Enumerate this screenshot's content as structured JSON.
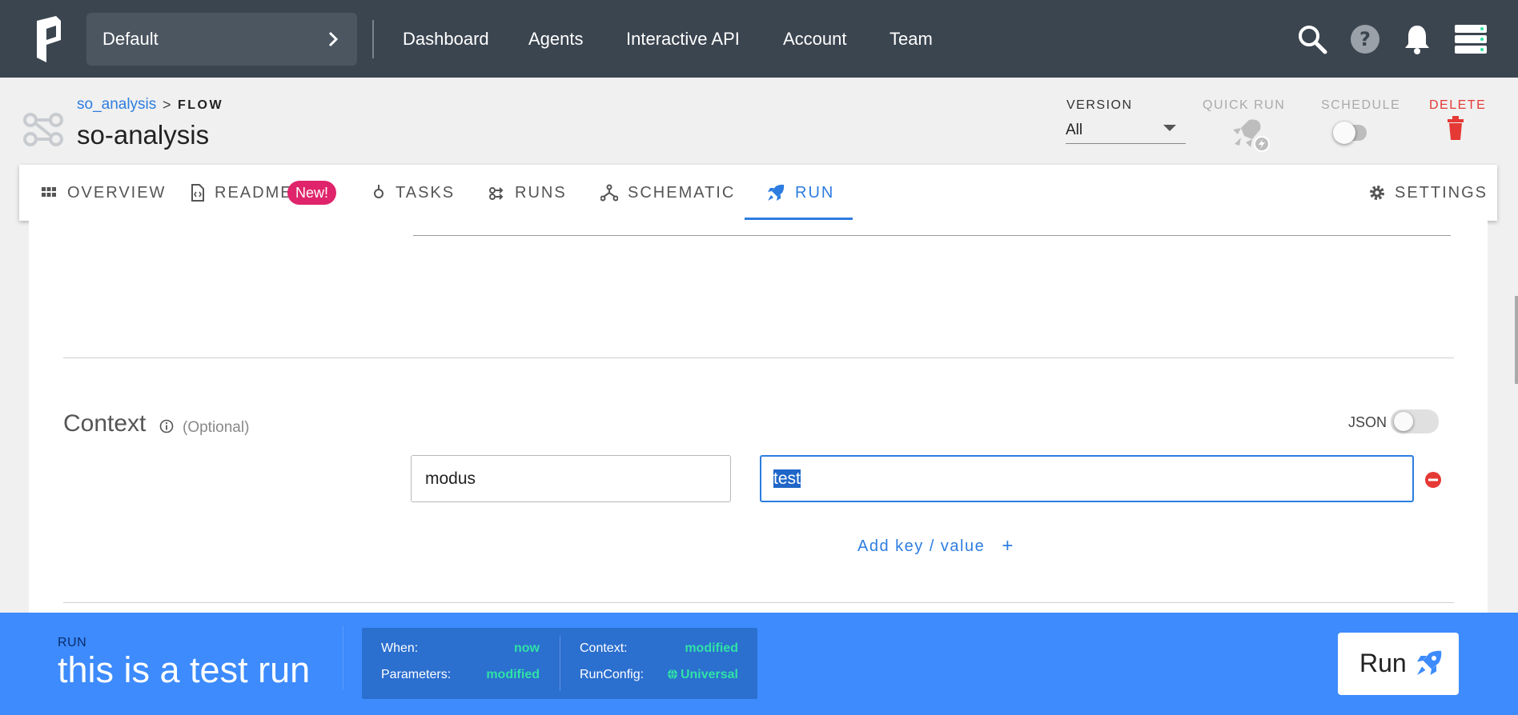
{
  "topbar": {
    "team": "Default",
    "nav": [
      "Dashboard",
      "Agents",
      "Interactive API",
      "Account",
      "Team"
    ],
    "icons": [
      "search-icon",
      "help-icon",
      "bell-icon",
      "server-icon"
    ]
  },
  "breadcrumb": {
    "project": "so_analysis",
    "type": "FLOW"
  },
  "flow": {
    "title": "so-analysis"
  },
  "header": {
    "version_label": "VERSION",
    "version_value": "All",
    "quick_run_label": "QUICK RUN",
    "schedule_label": "SCHEDULE",
    "schedule_on": false,
    "delete_label": "DELETE"
  },
  "tabs": [
    {
      "label": "OVERVIEW",
      "icon": "grid-icon"
    },
    {
      "label": "README",
      "icon": "file-code-icon",
      "badge": "New!"
    },
    {
      "label": "TASKS",
      "icon": "task-node-icon"
    },
    {
      "label": "RUNS",
      "icon": "runs-icon"
    },
    {
      "label": "SCHEMATIC",
      "icon": "schematic-icon"
    },
    {
      "label": "RUN",
      "icon": "rocket-icon",
      "active": true
    },
    {
      "label": "SETTINGS",
      "icon": "gear-icon"
    }
  ],
  "context": {
    "title": "Context",
    "optional": "(Optional)",
    "json_label": "JSON",
    "json_on": false,
    "key": "modus",
    "value": "test",
    "add_label": "Add key / value"
  },
  "runbar": {
    "label": "RUN",
    "name": "this is a test run",
    "summary": {
      "when_label": "When:",
      "when_value": "now",
      "parameters_label": "Parameters:",
      "parameters_value": "modified",
      "context_label": "Context:",
      "context_value": "modified",
      "runconfig_label": "RunConfig:",
      "runconfig_value": "Universal"
    },
    "button": "Run"
  },
  "colors": {
    "topbar": "#3b4550",
    "accent": "#2d7de0",
    "runbar": "#3d8bfd",
    "summary_value": "#2fe3a6",
    "delete": "#e53935",
    "badge": "#e0246b"
  }
}
